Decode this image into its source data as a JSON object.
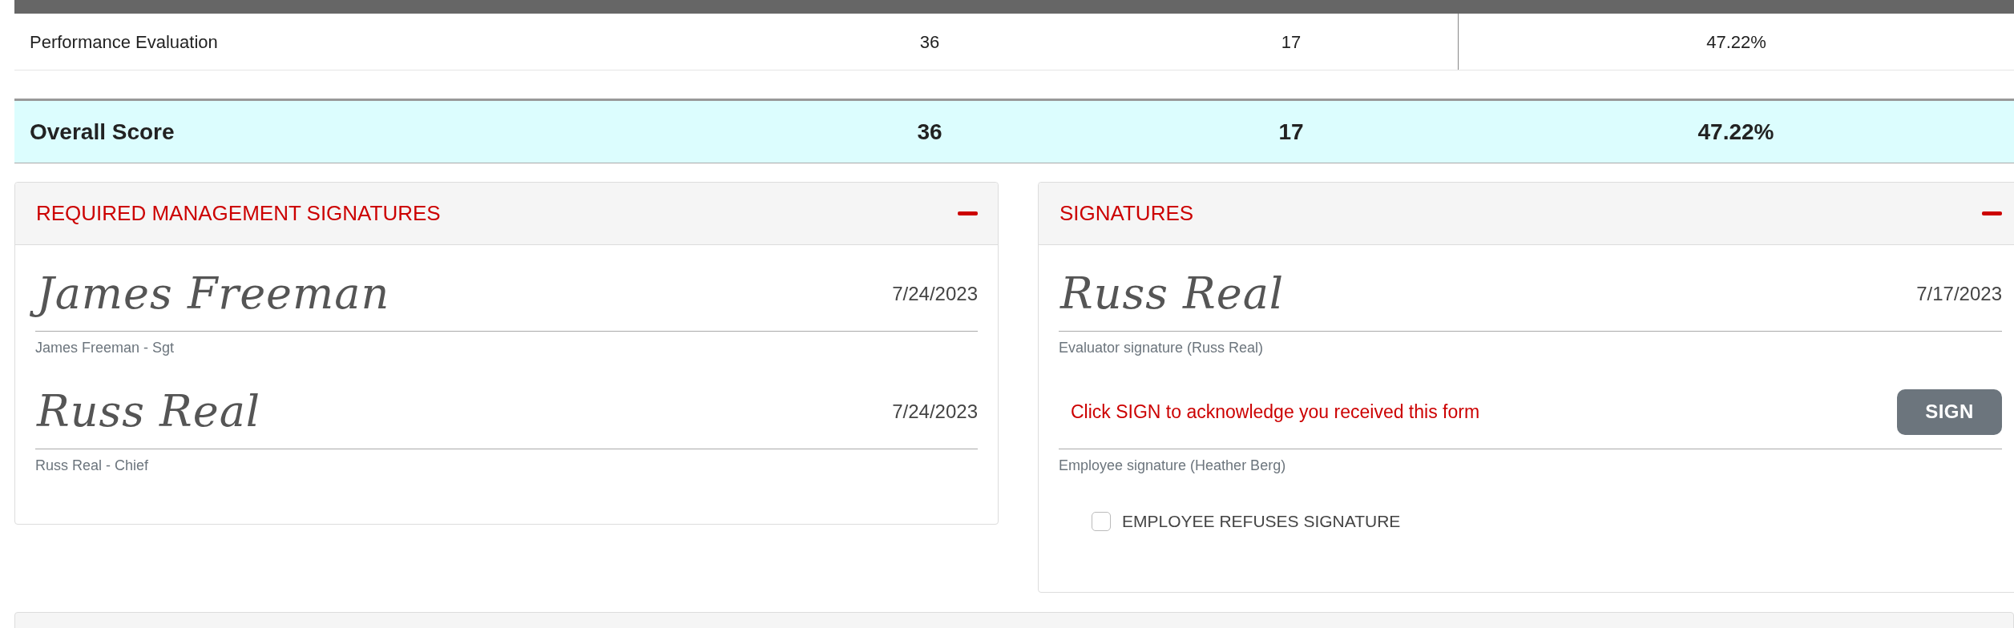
{
  "score_table": {
    "rows": [
      {
        "label": "Performance Evaluation",
        "values": [
          "36",
          "17",
          "47.22%"
        ]
      }
    ],
    "total": {
      "label": "Overall Score",
      "values": [
        "36",
        "17",
        "47.22%"
      ]
    }
  },
  "panels": [
    {
      "title": "REQUIRED MANAGEMENT SIGNATURES",
      "expanded": true,
      "items": [
        {
          "kind": "signature",
          "signature": "James Freeman",
          "date": "7/24/2023",
          "caption": "James Freeman - Sgt"
        },
        {
          "kind": "signature",
          "signature": "Russ Real",
          "date": "7/24/2023",
          "caption": "Russ Real - Chief"
        }
      ]
    },
    {
      "title": "SIGNATURES",
      "expanded": true,
      "items": [
        {
          "kind": "signature",
          "signature": "Russ Real",
          "date": "7/17/2023",
          "caption": "Evaluator signature (Russ Real)"
        },
        {
          "kind": "pending",
          "prompt": "Click SIGN to acknowledge you received this form",
          "button": "SIGN",
          "caption": "Employee signature (Heather Berg)"
        },
        {
          "kind": "checkbox",
          "label": "EMPLOYEE REFUSES SIGNATURE",
          "checked": false
        }
      ]
    }
  ]
}
